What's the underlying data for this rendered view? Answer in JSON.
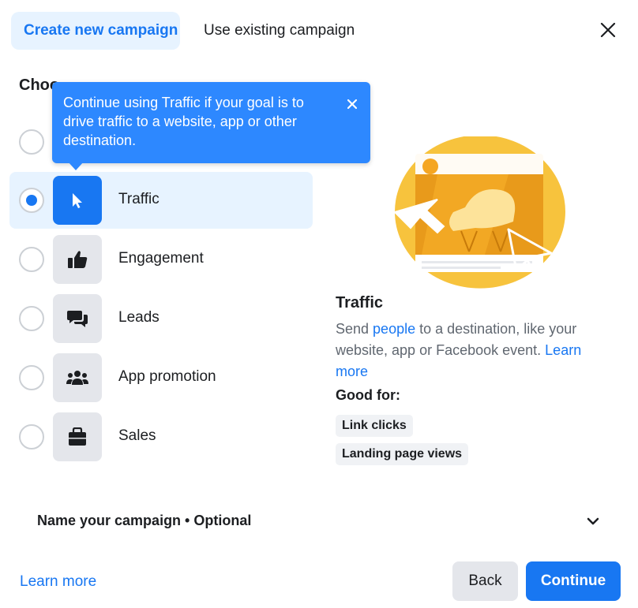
{
  "tabs": {
    "create_label": "Create new campaign",
    "existing_label": "Use existing campaign"
  },
  "section": {
    "title_visible": "Choo"
  },
  "tooltip": {
    "text": "Continue using Traffic if your goal is to drive traffic to a website, app or other destination."
  },
  "objectives": [
    {
      "label": "",
      "icon": "hidden-icon",
      "selected": false
    },
    {
      "label": "Traffic",
      "icon": "cursor-icon",
      "selected": true
    },
    {
      "label": "Engagement",
      "icon": "thumbs-up-icon",
      "selected": false
    },
    {
      "label": "Leads",
      "icon": "chat-bubbles-icon",
      "selected": false
    },
    {
      "label": "App promotion",
      "icon": "people-icon",
      "selected": false
    },
    {
      "label": "Sales",
      "icon": "shopping-bag-icon",
      "selected": false
    }
  ],
  "detail": {
    "title": "Traffic",
    "desc_start": "Send ",
    "desc_link": "people",
    "desc_mid": " to a destination, like your website, app or Facebook event. ",
    "desc_learn": "Learn more",
    "good_for": "Good for:",
    "chips": [
      "Link clicks",
      "Landing page views"
    ]
  },
  "name_campaign": {
    "label": "Name your campaign • Optional"
  },
  "footer": {
    "learn_more": "Learn more",
    "back": "Back",
    "continue": "Continue"
  },
  "colors": {
    "accent": "#1877f2",
    "tooltip_bg": "#2d88ff",
    "selected_bg": "#e7f3ff",
    "illustration_yellow": "#f7c33d"
  }
}
